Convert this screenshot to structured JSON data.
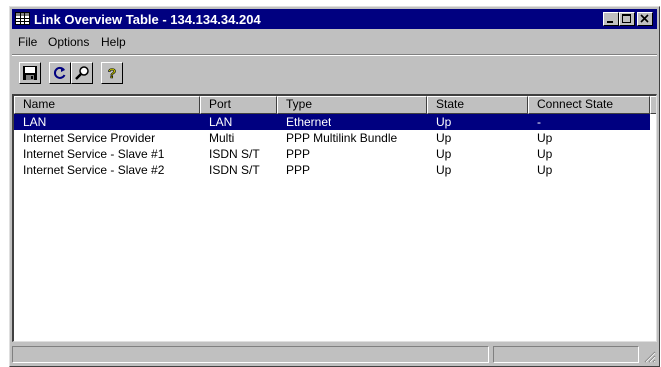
{
  "window": {
    "title": "Link Overview Table - 134.134.34.204",
    "controls": {
      "minimize": "minimize",
      "maximize": "maximize",
      "close": "close"
    }
  },
  "menu": [
    {
      "label": "File"
    },
    {
      "label": "Options"
    },
    {
      "label": "Help"
    }
  ],
  "toolbar": [
    {
      "icon": "save-icon"
    },
    {
      "icon": "refresh-icon"
    },
    {
      "icon": "search-icon"
    },
    {
      "icon": "help-icon"
    }
  ],
  "table": {
    "columns": [
      "Name",
      "Port",
      "Type",
      "State",
      "Connect State"
    ],
    "rows": [
      {
        "name": "LAN",
        "port": "LAN",
        "type": "Ethernet",
        "state": "Up",
        "connect": "-",
        "selected": true
      },
      {
        "name": "Internet Service Provider",
        "port": "Multi",
        "type": "PPP Multilink Bundle",
        "state": "Up",
        "connect": "Up",
        "selected": false
      },
      {
        "name": "Internet Service  - Slave #1",
        "port": "ISDN S/T",
        "type": "PPP",
        "state": "Up",
        "connect": "Up",
        "selected": false
      },
      {
        "name": "Internet Service  - Slave #2",
        "port": "ISDN S/T",
        "type": "PPP",
        "state": "Up",
        "connect": "Up",
        "selected": false
      }
    ]
  },
  "colors": {
    "title_bar": "#000080",
    "selection": "#000080",
    "face": "#c0c0c0"
  }
}
